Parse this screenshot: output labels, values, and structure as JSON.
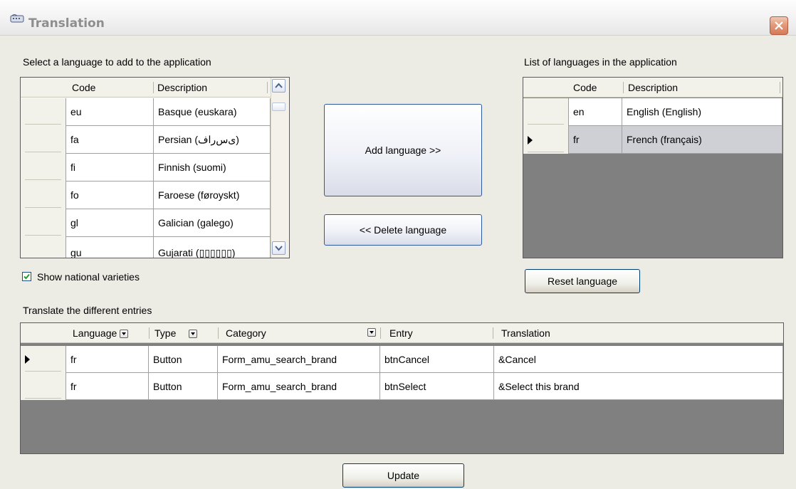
{
  "window": {
    "title": "Translation",
    "icon": "keyboard-icon",
    "close": "close-icon"
  },
  "left_section": {
    "label": "Select a language to add to the application",
    "headers": {
      "code": "Code",
      "description": "Description"
    },
    "rows": [
      {
        "code": "eu",
        "description": "Basque (euskara)"
      },
      {
        "code": "fa",
        "description": "Persian (ی‌س‌راف)"
      },
      {
        "code": "fi",
        "description": "Finnish (suomi)"
      },
      {
        "code": "fo",
        "description": "Faroese (føroyskt)"
      },
      {
        "code": "gl",
        "description": "Galician (galego)"
      },
      {
        "code": "gu",
        "description": "Gujarati (▯▯▯▯▯▯)"
      }
    ]
  },
  "buttons": {
    "add": "Add language >>",
    "delete": "<< Delete language",
    "reset": "Reset language",
    "update": "Update"
  },
  "checkbox": {
    "label": "Show national varieties",
    "checked": true
  },
  "right_section": {
    "label": "List of languages in the application",
    "headers": {
      "code": "Code",
      "description": "Description"
    },
    "rows": [
      {
        "code": "en",
        "description": "English (English)"
      },
      {
        "code": "fr",
        "description": "French (français)"
      }
    ]
  },
  "bottom_section": {
    "label": "Translate the different entries",
    "headers": {
      "language": "Language",
      "type": "Type",
      "category": "Category",
      "entry": "Entry",
      "translation": "Translation"
    },
    "rows": [
      {
        "language": "fr",
        "type": "Button",
        "category": "Form_amu_search_brand",
        "entry": "btnCancel",
        "translation": "&Cancel"
      },
      {
        "language": "fr",
        "type": "Button",
        "category": "Form_amu_search_brand",
        "entry": "btnSelect",
        "translation": "&Select this brand"
      }
    ]
  },
  "colors": {
    "selected_row": "#cfcfd6",
    "grid_background": "#808080",
    "window_background": "#ecebe4"
  }
}
